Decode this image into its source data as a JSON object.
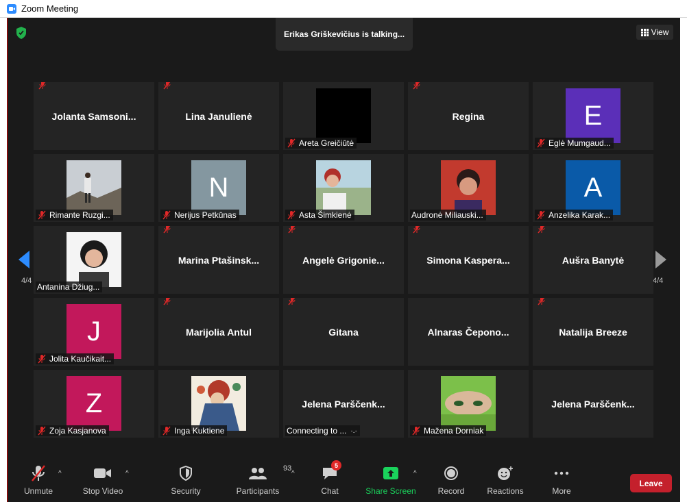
{
  "window": {
    "title": "Zoom Meeting"
  },
  "meeting": {
    "talking_indicator": "Erikas Griškevičius is talking...",
    "view_label": "View",
    "page_indicator_left": "4/4",
    "page_indicator_right": "4/4"
  },
  "tiles": [
    {
      "name": "Jolanta  Samsoni...",
      "label": ""
    },
    {
      "name": "Lina Janulienė",
      "label": ""
    },
    {
      "name": "",
      "label": "Areta Greičiūtė"
    },
    {
      "name": "Regina",
      "label": ""
    },
    {
      "name": "",
      "label": "Eglė Mumgaud...",
      "avatar_letter": "E"
    },
    {
      "name": "",
      "label": "Rimante Ruzgi..."
    },
    {
      "name": "",
      "label": "Nerijus Petkūnas",
      "avatar_letter": "N"
    },
    {
      "name": "",
      "label": "Asta Šimkienė"
    },
    {
      "name": "",
      "label": "Audronė Miliauski..."
    },
    {
      "name": "",
      "label": "Anzelika Karak...",
      "avatar_letter": "A"
    },
    {
      "name": "",
      "label": "Antanina Džiug..."
    },
    {
      "name": "Marina  Ptašinsk...",
      "label": ""
    },
    {
      "name": "Angelė  Grigonie...",
      "label": ""
    },
    {
      "name": "Simona  Kaspera...",
      "label": ""
    },
    {
      "name": "Aušra Banytė",
      "label": ""
    },
    {
      "name": "",
      "label": "Jolita Kaučikait...",
      "avatar_letter": "J"
    },
    {
      "name": "Marijolia Antul",
      "label": ""
    },
    {
      "name": "Gitana",
      "label": ""
    },
    {
      "name": "Alnaras  Čepono...",
      "label": ""
    },
    {
      "name": "Natalija Breeze",
      "label": ""
    },
    {
      "name": "",
      "label": "Zoja Kasjanova",
      "avatar_letter": "Z"
    },
    {
      "name": "",
      "label": "Inga Kuktiene"
    },
    {
      "name": "Jelena  Parščenk...",
      "label": "Connecting to ..."
    },
    {
      "name": "",
      "label": "Mažena Dorniak"
    },
    {
      "name": "Jelena  Parščenk...",
      "label": ""
    }
  ],
  "toolbar": {
    "unmute": "Unmute",
    "stop_video": "Stop Video",
    "security": "Security",
    "participants": "Participants",
    "participants_count": "93",
    "chat": "Chat",
    "chat_badge": "5",
    "share_screen": "Share Screen",
    "record": "Record",
    "reactions": "Reactions",
    "more": "More",
    "leave": "Leave"
  },
  "colors": {
    "avatar_E": "#5b2fb8",
    "avatar_N": "#8497a0",
    "avatar_A": "#0a5aa8",
    "avatar_J": "#c2185b",
    "avatar_Z": "#c2185b",
    "share_green": "#1ad35c",
    "leave_red": "#c4202c",
    "accent_blue": "#2d8cff"
  },
  "icons": {
    "mic_off": "mic-off-icon",
    "camera": "camera-icon",
    "shield": "shield-icon",
    "participants": "participants-icon",
    "chat": "chat-icon",
    "share": "share-screen-icon",
    "record": "record-icon",
    "reactions": "reactions-icon",
    "more": "more-icon"
  }
}
